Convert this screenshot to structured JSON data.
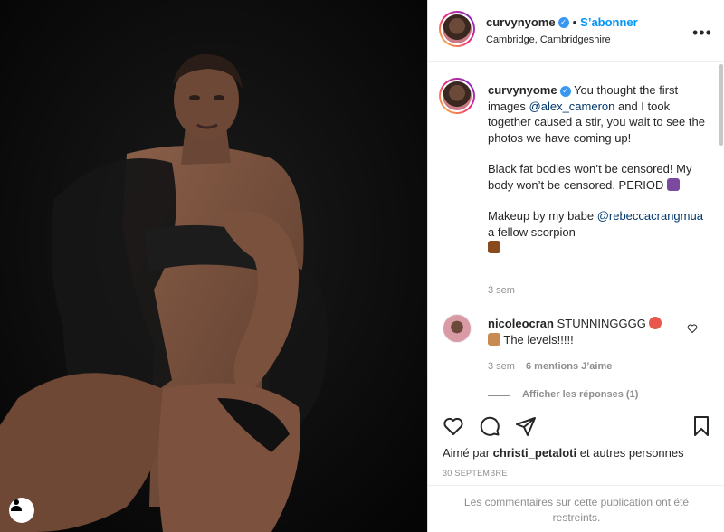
{
  "post": {
    "username": "curvynyome",
    "follow_label": "S’abonner",
    "separator": "•",
    "location": "Cambridge, Cambridgeshire",
    "more_label": "•••"
  },
  "caption": {
    "username": "curvynyome",
    "line1_prefix": " You thought the first images ",
    "mention1": "@alex_cameron",
    "line1_suffix": " and I took together caused a stir, you wait to see the photos we have coming up!",
    "line2": "Black fat bodies won’t be censored! My body won’t be censored. PERIOD",
    "line3_prefix": "Makeup by my babe ",
    "mention2": "@rebeccacrangmua",
    "line3_suffix": " a fellow scorpion",
    "time": "3 sem"
  },
  "comment": {
    "username": "nicoleocran",
    "text": " STUNNINGGGG",
    "text2": " The levels!!!!!",
    "time": "3 sem",
    "likes": "6 mentions J’aime",
    "replies_label": "Afficher les réponses (1)"
  },
  "footer": {
    "liked_prefix": "Aimé par ",
    "liked_user": "christi_petaloti",
    "liked_suffix": " et autres personnes",
    "date": "30 SEPTEMBRE",
    "restricted": "Les commentaires sur cette publication ont été restreints."
  },
  "colors": {
    "accent_blue": "#0095f6",
    "verified_blue": "#3897f0",
    "mention_blue": "#00376b",
    "muted_gray": "#8e8e8e"
  },
  "icons": {
    "like": "heart-icon",
    "comment": "comment-icon",
    "share": "share-icon",
    "save": "bookmark-icon",
    "more": "more-options-icon",
    "user": "user-icon"
  }
}
